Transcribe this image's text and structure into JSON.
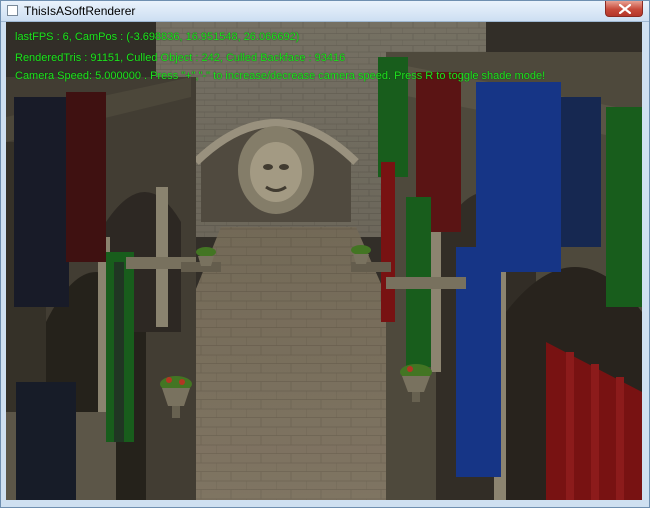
{
  "window": {
    "title": "ThisIsASoftRenderer"
  },
  "hud": {
    "line1": "lastFPS : 6, CamPos : (-3.698836, 16.951548, 26.066692)",
    "line2": "RenderedTris : 91151, Culled Object : 242, Culled Backface : 93416",
    "line3": "Camera Speed: 5.000000 . Press \"+\",\"-\" to increase/decrease camera speed. Press R to toggle shade mode!"
  },
  "colors": {
    "hud_text": "#20e020",
    "banner_blue": "#1b3f9e",
    "banner_red": "#8e1616",
    "banner_green": "#1d6e22",
    "stone": "#8d826c"
  },
  "icons": {
    "app": "window-app-icon",
    "close": "close-icon"
  }
}
